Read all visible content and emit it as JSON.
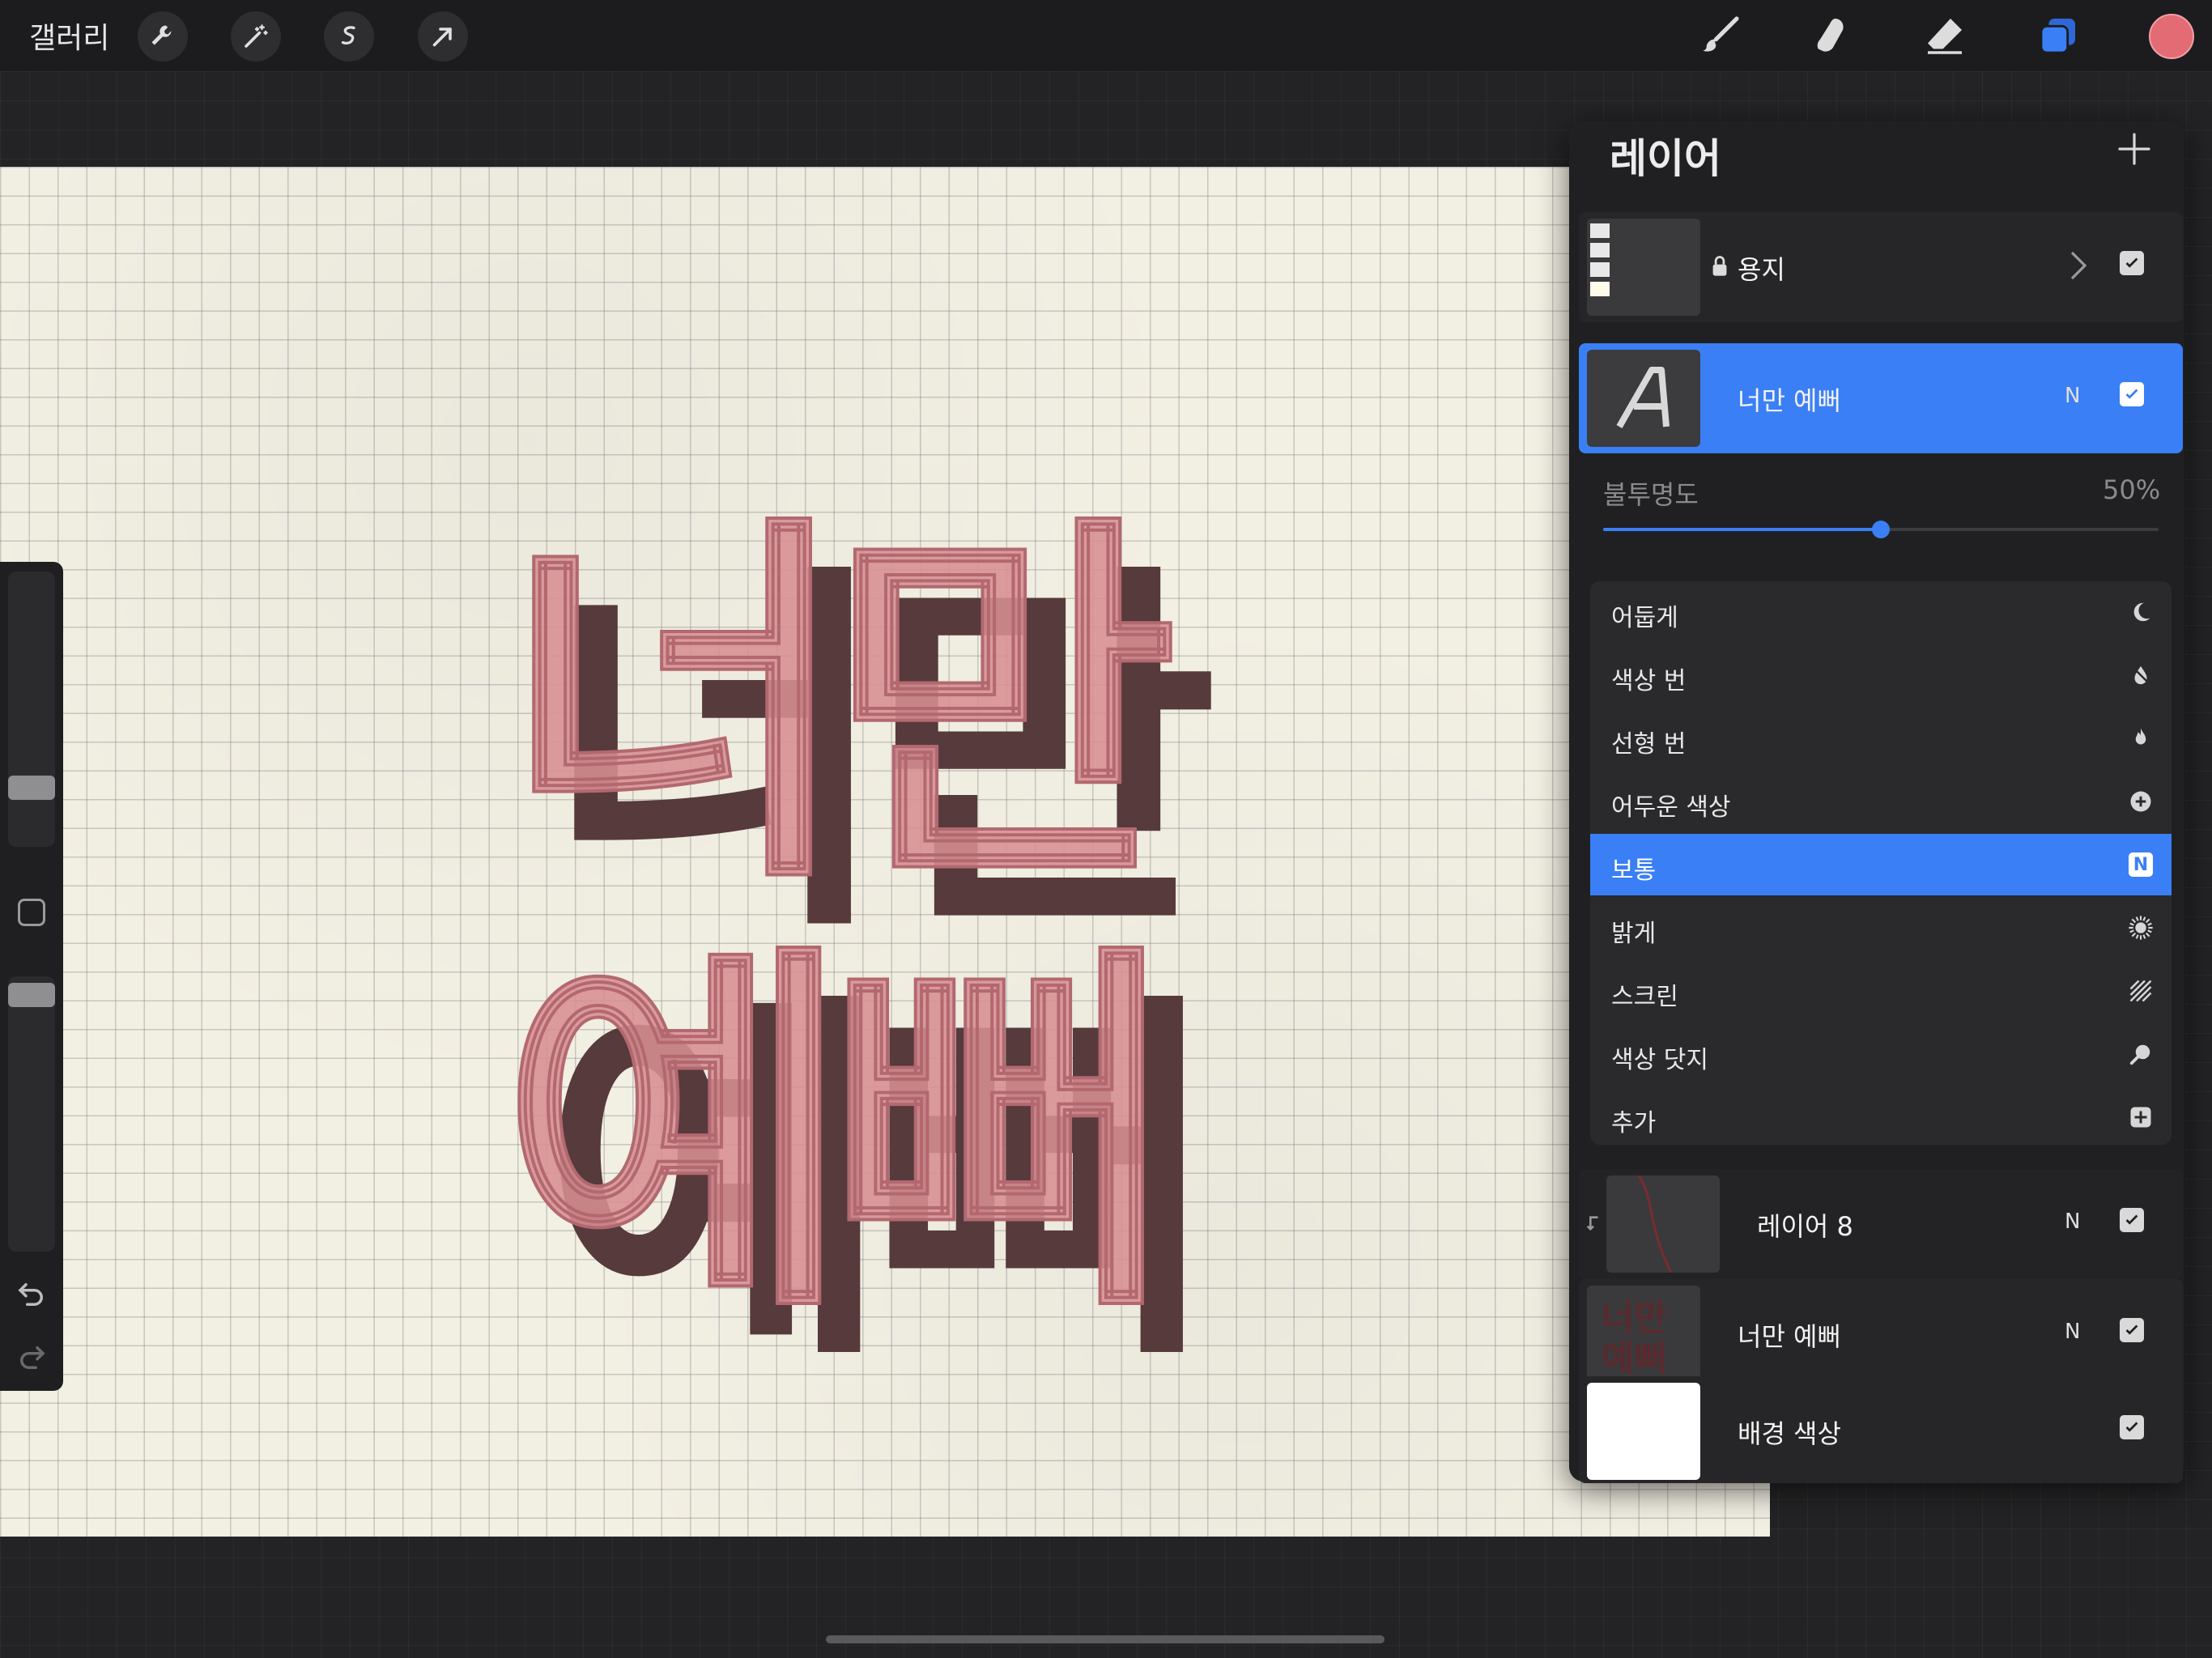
{
  "topbar": {
    "gallery_label": "갤러리"
  },
  "canvas": {
    "artwork_text": [
      "너만",
      "예뻐"
    ],
    "colors": {
      "face": "#d78e92",
      "shadow": "#5a3a3c"
    }
  },
  "layers_panel": {
    "title": "레이어",
    "opacity_label": "불투명도",
    "opacity_value": "50%",
    "opacity_fraction": 0.5,
    "layers": [
      {
        "name": "용지",
        "locked": true,
        "visible": true
      },
      {
        "name": "너만 예뻐",
        "mode": "N",
        "visible": true,
        "active": true,
        "type": "text-icon"
      },
      {
        "name": "레이어 8",
        "mode": "N",
        "visible": true
      },
      {
        "name": "너만 예뻐",
        "mode": "N",
        "visible": true
      },
      {
        "name": "배경 색상",
        "visible": true
      }
    ],
    "blend_modes": [
      {
        "label": "어둡게",
        "icon": "moon-icon"
      },
      {
        "label": "색상 번",
        "icon": "burn-icon"
      },
      {
        "label": "선형 번",
        "icon": "flame-icon"
      },
      {
        "label": "어두운 색상",
        "icon": "plus-circle-icon"
      },
      {
        "label": "보통",
        "icon": "N",
        "selected": true
      },
      {
        "label": "밝게",
        "icon": "sun-icon"
      },
      {
        "label": "스크린",
        "icon": "stripes-icon"
      },
      {
        "label": "색상 닷지",
        "icon": "magnifier-icon"
      },
      {
        "label": "추가",
        "icon": "plus-square-icon"
      }
    ]
  },
  "accent_color": "#3a7ff5",
  "brush_color": "#e36b74"
}
